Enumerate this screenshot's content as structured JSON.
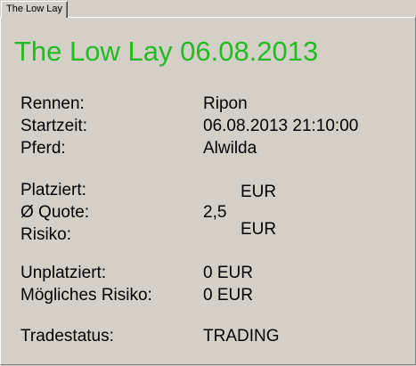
{
  "tab": {
    "label": "The Low Lay"
  },
  "title": "The Low Lay 06.08.2013",
  "rennen": {
    "label": "Rennen:",
    "value": "Ripon"
  },
  "startzeit": {
    "label": "Startzeit:",
    "value": "06.08.2013 21:10:00"
  },
  "pferd": {
    "label": "Pferd:",
    "value": "Alwilda"
  },
  "platziert": {
    "label": "Platziert:",
    "value": "EUR"
  },
  "quote": {
    "label": "Ø Quote:",
    "value": "2,5"
  },
  "risiko": {
    "label": "Risiko:",
    "value": "EUR"
  },
  "unplatziert": {
    "label": "Unplatziert:",
    "value": "0 EUR"
  },
  "moegliches_risiko": {
    "label": "Mögliches Risiko:",
    "value": "0 EUR"
  },
  "tradestatus": {
    "label": "Tradestatus:",
    "value": "TRADING"
  },
  "colors": {
    "title": "#22bb22",
    "background": "#d4d0c8"
  }
}
